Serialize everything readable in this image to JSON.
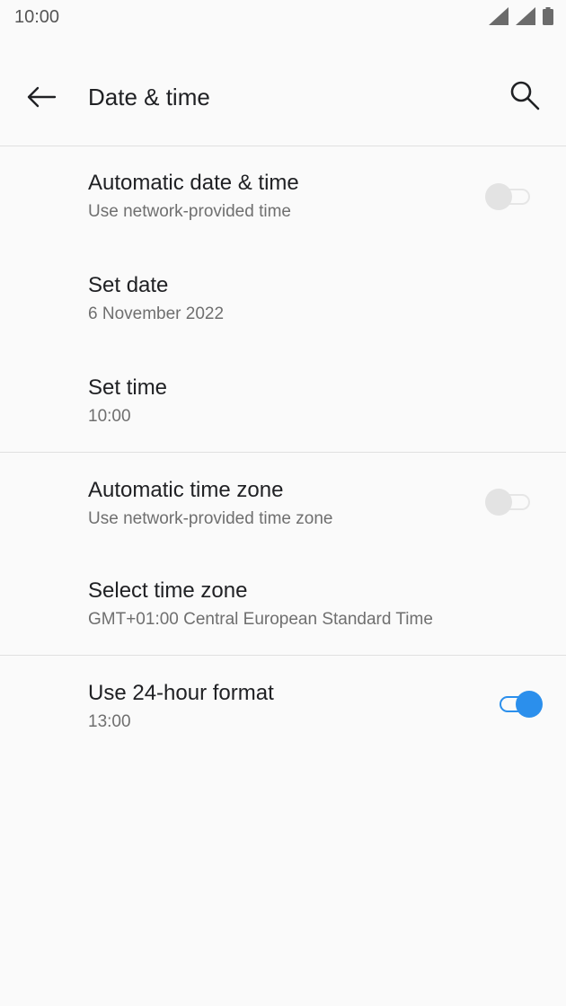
{
  "status_bar": {
    "time": "10:00",
    "icons": [
      "signal-icon",
      "signal-icon",
      "battery-icon"
    ]
  },
  "header": {
    "title": "Date & time",
    "back_icon": "back-arrow-icon",
    "search_icon": "search-icon"
  },
  "settings": {
    "auto_date_time": {
      "title": "Automatic date & time",
      "subtitle": "Use network-provided time",
      "enabled": false
    },
    "set_date": {
      "title": "Set date",
      "subtitle": "6 November 2022"
    },
    "set_time": {
      "title": "Set time",
      "subtitle": "10:00"
    },
    "auto_time_zone": {
      "title": "Automatic time zone",
      "subtitle": "Use network-provided time zone",
      "enabled": false
    },
    "select_time_zone": {
      "title": "Select time zone",
      "subtitle": "GMT+01:00 Central European Standard Time"
    },
    "use_24_hour": {
      "title": "Use 24-hour format",
      "subtitle": "13:00",
      "enabled": true
    }
  },
  "colors": {
    "accent": "#2b8fec",
    "background": "#fafafa",
    "divider": "#e0e0e0"
  }
}
